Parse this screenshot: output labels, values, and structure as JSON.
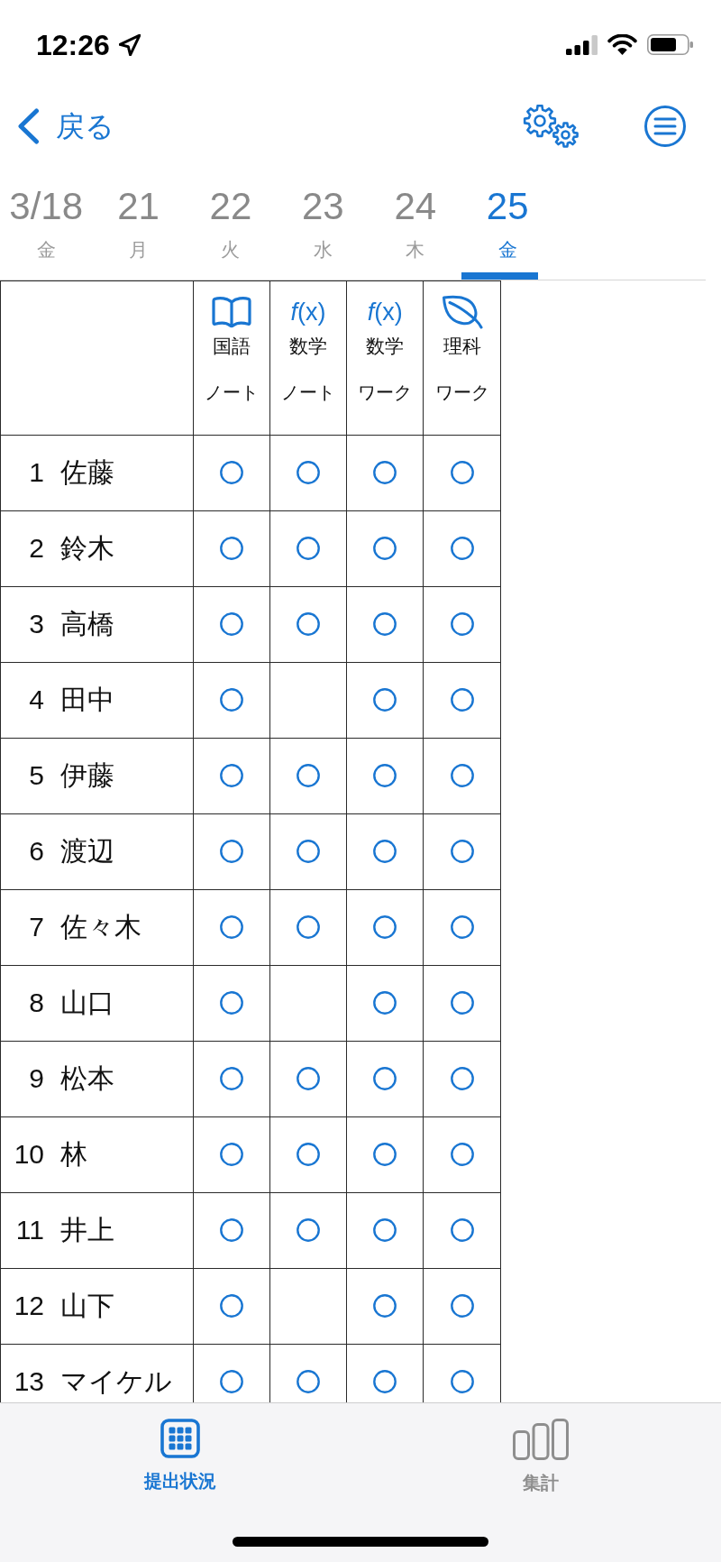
{
  "status_bar": {
    "time": "12:26"
  },
  "nav_bar": {
    "back_label": "戻る"
  },
  "date_tabs": [
    {
      "date": "3/18",
      "weekday": "金",
      "selected": false
    },
    {
      "date": "21",
      "weekday": "月",
      "selected": false
    },
    {
      "date": "22",
      "weekday": "火",
      "selected": false
    },
    {
      "date": "23",
      "weekday": "水",
      "selected": false
    },
    {
      "date": "24",
      "weekday": "木",
      "selected": false
    },
    {
      "date": "25",
      "weekday": "金",
      "selected": true
    }
  ],
  "table": {
    "columns": [
      {
        "kind": "book",
        "subject": "国語",
        "type": "ノート"
      },
      {
        "kind": "formula",
        "symbol": "*f*(x)",
        "subject": "数学",
        "type": "ノート"
      },
      {
        "kind": "formula",
        "symbol": "*f*(x)",
        "subject": "数学",
        "type": "ワーク"
      },
      {
        "kind": "leaf",
        "subject": "理科",
        "type": "ワーク"
      }
    ],
    "rows": [
      {
        "number": "1",
        "name": "佐藤",
        "cells": [
          {
            "submitted": true
          },
          {
            "submitted": true
          },
          {
            "submitted": true
          },
          {
            "submitted": true
          }
        ]
      },
      {
        "number": "2",
        "name": "鈴木",
        "cells": [
          {
            "submitted": true
          },
          {
            "submitted": true
          },
          {
            "submitted": true
          },
          {
            "submitted": true
          }
        ]
      },
      {
        "number": "3",
        "name": "高橋",
        "cells": [
          {
            "submitted": true
          },
          {
            "submitted": true
          },
          {
            "submitted": true
          },
          {
            "submitted": true
          }
        ]
      },
      {
        "number": "4",
        "name": "田中",
        "cells": [
          {
            "submitted": true
          },
          {
            "submitted": false
          },
          {
            "submitted": true
          },
          {
            "submitted": true
          }
        ]
      },
      {
        "number": "5",
        "name": "伊藤",
        "cells": [
          {
            "submitted": true
          },
          {
            "submitted": true
          },
          {
            "submitted": true
          },
          {
            "submitted": true
          }
        ]
      },
      {
        "number": "6",
        "name": "渡辺",
        "cells": [
          {
            "submitted": true
          },
          {
            "submitted": true
          },
          {
            "submitted": true
          },
          {
            "submitted": true
          }
        ]
      },
      {
        "number": "7",
        "name": "佐々木",
        "cells": [
          {
            "submitted": true
          },
          {
            "submitted": true
          },
          {
            "submitted": true
          },
          {
            "submitted": true
          }
        ]
      },
      {
        "number": "8",
        "name": "山口",
        "cells": [
          {
            "submitted": true
          },
          {
            "submitted": false
          },
          {
            "submitted": true
          },
          {
            "submitted": true
          }
        ]
      },
      {
        "number": "9",
        "name": "松本",
        "cells": [
          {
            "submitted": true
          },
          {
            "submitted": true
          },
          {
            "submitted": true
          },
          {
            "submitted": true
          }
        ]
      },
      {
        "number": "10",
        "name": "林",
        "cells": [
          {
            "submitted": true
          },
          {
            "submitted": true
          },
          {
            "submitted": true
          },
          {
            "submitted": true
          }
        ]
      },
      {
        "number": "11",
        "name": "井上",
        "cells": [
          {
            "submitted": true
          },
          {
            "submitted": true
          },
          {
            "submitted": true
          },
          {
            "submitted": true
          }
        ]
      },
      {
        "number": "12",
        "name": "山下",
        "cells": [
          {
            "submitted": true
          },
          {
            "submitted": false
          },
          {
            "submitted": true
          },
          {
            "submitted": true
          }
        ]
      },
      {
        "number": "13",
        "name": "マイケル",
        "cells": [
          {
            "submitted": true
          },
          {
            "submitted": true
          },
          {
            "submitted": true
          },
          {
            "submitted": true
          }
        ]
      }
    ]
  },
  "tab_bar": {
    "items": [
      {
        "kind": "grid",
        "label": "提出状況",
        "selected": true
      },
      {
        "kind": "chart",
        "label": "集計",
        "selected": false
      }
    ]
  }
}
